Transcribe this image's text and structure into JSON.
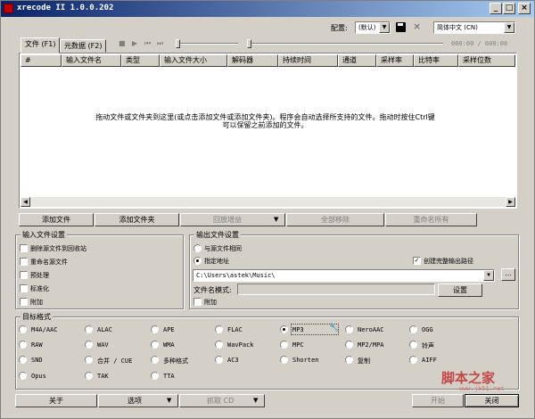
{
  "window": {
    "title": "xrecode II 1.0.0.202"
  },
  "toolbar": {
    "config_label": "配置:",
    "config_value": "(默认)",
    "language_value": "简体中文 (CN)",
    "time_readout": "000:00 / 000:00"
  },
  "tabs": [
    {
      "label": "文件 (F1)"
    },
    {
      "label": "元数据 (F2)"
    }
  ],
  "file_list": {
    "columns": [
      "#",
      "输入文件名",
      "类型",
      "输入文件大小",
      "解码器",
      "持续时间",
      "通道",
      "采样率",
      "比特率",
      "采样位数"
    ],
    "hint_line1": "拖动文件或文件夹到这里(或点击添加文件或添加文件夹)。程序会自动选择所支持的文件。拖动时按住Ctrl键",
    "hint_line2": "可以保留之前添加的文件。"
  },
  "list_buttons": {
    "add_file": "添加文件",
    "add_folder": "添加文件夹",
    "replay_gain": "回放增益",
    "remove_all": "全部移除",
    "rename_all": "重命名所有"
  },
  "input_settings": {
    "legend": "输入文件设置",
    "options": [
      {
        "label": "删除源文件到回收站",
        "checked": false
      },
      {
        "label": "重命名源文件",
        "checked": false
      },
      {
        "label": "预处理",
        "checked": false
      },
      {
        "label": "标准化",
        "checked": false
      },
      {
        "label": "附加",
        "checked": false
      }
    ]
  },
  "output_settings": {
    "legend": "输出文件设置",
    "same_as_input": "与源文件相同",
    "specified_path": "指定地址",
    "create_full_path": "创建完整输出路径",
    "path_value": "C:\\Users\\astek\\Music\\",
    "browse_label": "...",
    "filename_pattern_label": "文件名模式:",
    "settings_button": "设置",
    "append": "附加"
  },
  "target_format": {
    "legend": "目标格式",
    "selected": "MP3",
    "formats": [
      "M4A/AAC",
      "ALAC",
      "APE",
      "FLAC",
      "MP3",
      "NeroAAC",
      "OGG",
      "RAW",
      "WAV",
      "WMA",
      "WavPack",
      "MPC",
      "MP2/MPA",
      "铃声",
      "SND",
      "合并 / CUE",
      "多种格式",
      "AC3",
      "Shorten",
      "复制",
      "AIFF",
      "Opus",
      "TAK",
      "TTA"
    ]
  },
  "bottom_bar": {
    "about": "关于",
    "options": "选项",
    "rip": "抓取 CD",
    "start": "开始",
    "close": "关闭"
  },
  "watermark": {
    "text": "脚本之家",
    "sub": "www.jb51.net"
  },
  "colors": {
    "titlebar_start": "#0a246a",
    "titlebar_end": "#a6caf0",
    "face": "#d4d0c8",
    "watermark": "#c03030"
  }
}
